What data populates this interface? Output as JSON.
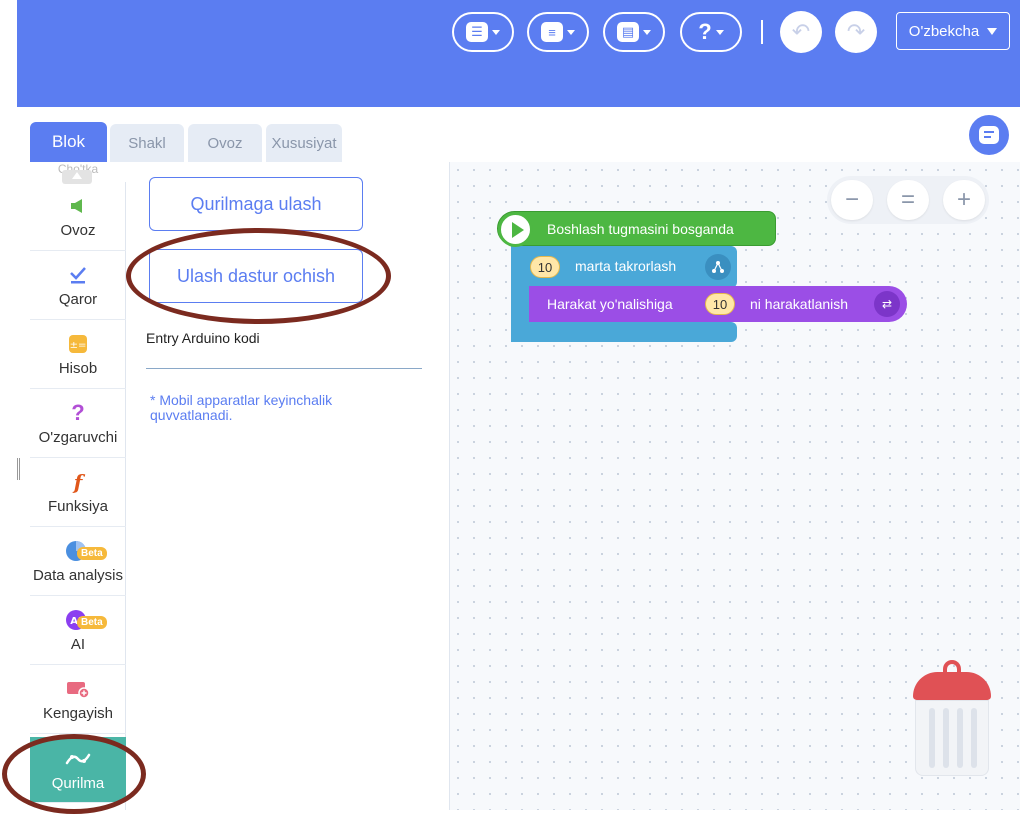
{
  "toolbar": {
    "buttons": [
      {
        "name": "menu-button",
        "icon": "menu-icon"
      },
      {
        "name": "file-button",
        "icon": "file-icon"
      },
      {
        "name": "save-button",
        "icon": "save-icon"
      },
      {
        "name": "help-button",
        "label": "?"
      }
    ],
    "undo_icon": "undo-icon",
    "redo_icon": "redo-icon",
    "language": "O'zbekcha"
  },
  "tabs": {
    "blok": "Blok",
    "shakl": "Shakl",
    "ovoz": "Ovoz",
    "xususiyat": "Xususiyat"
  },
  "categories": {
    "top_partial": "Cho'tka",
    "items": [
      {
        "label": "Ovoz"
      },
      {
        "label": "Qaror"
      },
      {
        "label": "Hisob"
      },
      {
        "label": "O'zgaruvchi"
      },
      {
        "label": "Funksiya"
      },
      {
        "label": "Data analysis",
        "badge": "Beta"
      },
      {
        "label": "AI",
        "badge": "Beta"
      },
      {
        "label": "Kengayish"
      },
      {
        "label": "Qurilma"
      }
    ]
  },
  "palette": {
    "connect_button": "Qurilmaga ulash",
    "open_program_button": "Ulash dastur ochish",
    "arduino_label": "Entry Arduino kodi",
    "mobile_note": "* Mobil apparatlar keyinchalik quvvatlanadi."
  },
  "workspace": {
    "zoom": {
      "out": "−",
      "reset": "=",
      "in": "+"
    },
    "start_block": "Boshlash tugmasini bosganda",
    "repeat_block": {
      "count": "10",
      "text": "marta takrorlash"
    },
    "move_block": {
      "prefix": "Harakat yo'nalishiga",
      "count": "10",
      "suffix": "ni harakatlanish"
    }
  },
  "colors": {
    "accent": "#5b7df1",
    "active_category": "#4ab5a6",
    "start_block": "#4db742",
    "repeat_block": "#4aa8d8",
    "move_block": "#9b4ee6",
    "annotation": "#7b2a1f"
  }
}
